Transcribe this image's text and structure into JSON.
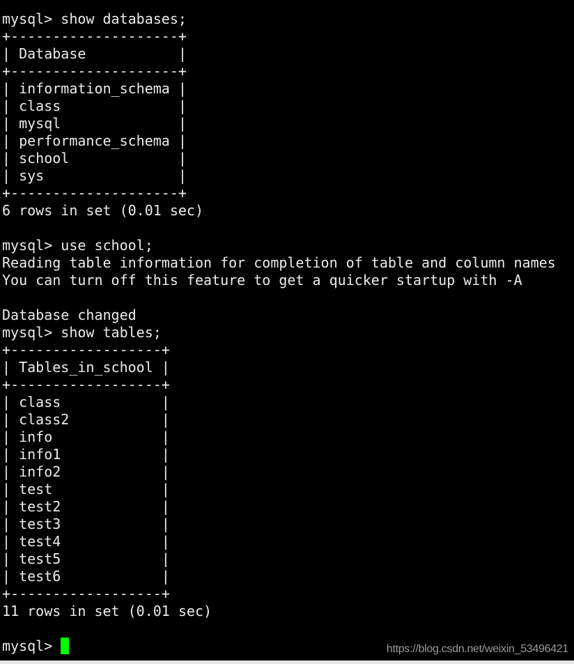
{
  "terminal": {
    "lines": [
      "mysql> show databases;",
      "+--------------------+",
      "| Database           |",
      "+--------------------+",
      "| information_schema |",
      "| class              |",
      "| mysql              |",
      "| performance_schema |",
      "| school             |",
      "| sys                |",
      "+--------------------+",
      "6 rows in set (0.01 sec)",
      "",
      "mysql> use school;",
      "Reading table information for completion of table and column names",
      "You can turn off this feature to get a quicker startup with -A",
      "",
      "Database changed",
      "mysql> show tables;",
      "+------------------+",
      "| Tables_in_school |",
      "+------------------+",
      "| class            |",
      "| class2           |",
      "| info             |",
      "| info1            |",
      "| info2            |",
      "| test             |",
      "| test2            |",
      "| test3            |",
      "| test4            |",
      "| test5            |",
      "| test6            |",
      "+------------------+",
      "11 rows in set (0.01 sec)",
      ""
    ],
    "prompt": "mysql> ",
    "cursor_color": "#00ff00",
    "text_color": "#ececec",
    "background": "#000000"
  },
  "watermark": "https://blog.csdn.net/weixin_53496421"
}
